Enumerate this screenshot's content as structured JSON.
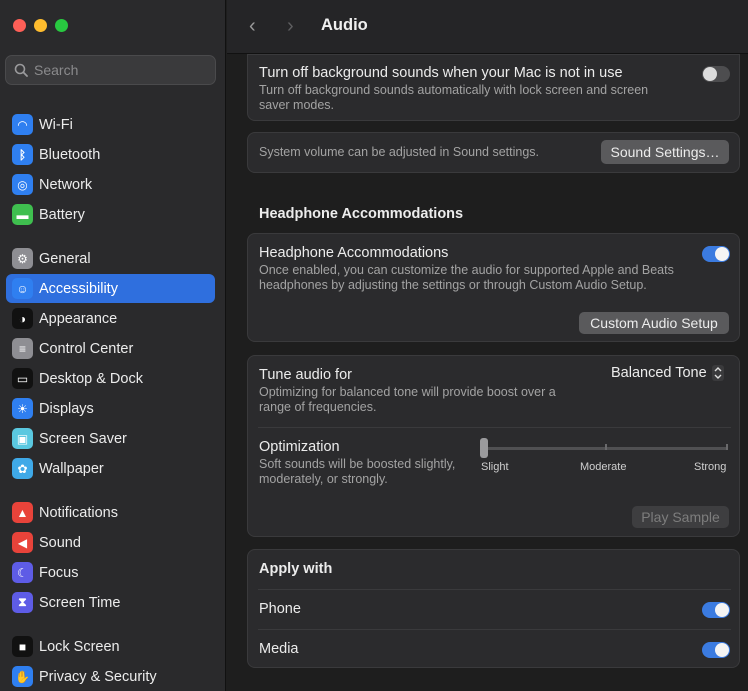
{
  "window": {
    "title": "Audio"
  },
  "colors": {
    "accent": "#2f6fde",
    "toggle_on": "#3b7be0"
  },
  "search": {
    "placeholder": "Search"
  },
  "sidebar": {
    "items": [
      {
        "label": "Wi-Fi",
        "icon": "wifi-icon",
        "color": "#2f7ff0"
      },
      {
        "label": "Bluetooth",
        "icon": "bluetooth-icon",
        "color": "#2f7ff0"
      },
      {
        "label": "Network",
        "icon": "globe-icon",
        "color": "#2f7ff0"
      },
      {
        "label": "Battery",
        "icon": "battery-icon",
        "color": "#3fbf4f"
      },
      {
        "label": "General",
        "icon": "gear-icon",
        "color": "#8e8e93"
      },
      {
        "label": "Accessibility",
        "icon": "accessibility-icon",
        "color": "#2f7ff0"
      },
      {
        "label": "Appearance",
        "icon": "appearance-icon",
        "color": "#111111"
      },
      {
        "label": "Control Center",
        "icon": "control-center-icon",
        "color": "#8e8e93"
      },
      {
        "label": "Desktop & Dock",
        "icon": "dock-icon",
        "color": "#111111"
      },
      {
        "label": "Displays",
        "icon": "sun-icon",
        "color": "#2f7ff0"
      },
      {
        "label": "Screen Saver",
        "icon": "screen-saver-icon",
        "color": "#5ac8e0"
      },
      {
        "label": "Wallpaper",
        "icon": "flower-icon",
        "color": "#3fa9e8"
      },
      {
        "label": "Notifications",
        "icon": "bell-icon",
        "color": "#e8433a"
      },
      {
        "label": "Sound",
        "icon": "speaker-icon",
        "color": "#e8433a"
      },
      {
        "label": "Focus",
        "icon": "moon-icon",
        "color": "#5e5ce6"
      },
      {
        "label": "Screen Time",
        "icon": "hourglass-icon",
        "color": "#5e5ce6"
      },
      {
        "label": "Lock Screen",
        "icon": "lock-icon",
        "color": "#111111"
      },
      {
        "label": "Privacy & Security",
        "icon": "hand-icon",
        "color": "#2f7ff0"
      }
    ]
  },
  "main": {
    "bg_sounds": {
      "title": "Turn off background sounds when your Mac is not in use",
      "desc": "Turn off background sounds automatically with lock screen and screen saver modes.",
      "enabled": false
    },
    "volume": {
      "desc": "System volume can be adjusted in Sound settings.",
      "button": "Sound Settings…"
    },
    "headphone_section": {
      "heading": "Headphone Accommodations"
    },
    "headphone": {
      "title": "Headphone Accommodations",
      "desc": "Once enabled, you can customize the audio for supported Apple and Beats headphones by adjusting the settings or through Custom Audio Setup.",
      "enabled": true,
      "button": "Custom Audio Setup"
    },
    "tune": {
      "title": "Tune audio for",
      "desc": "Optimizing for balanced tone will provide boost over a range of frequencies.",
      "value": "Balanced Tone"
    },
    "optimization": {
      "title": "Optimization",
      "desc": "Soft sounds will be boosted slightly, moderately, or strongly.",
      "labels": [
        "Slight",
        "Moderate",
        "Strong"
      ],
      "level": 0
    },
    "play_sample": "Play Sample",
    "apply": {
      "heading": "Apply with",
      "phone": {
        "label": "Phone",
        "enabled": true
      },
      "media": {
        "label": "Media",
        "enabled": true
      }
    }
  }
}
